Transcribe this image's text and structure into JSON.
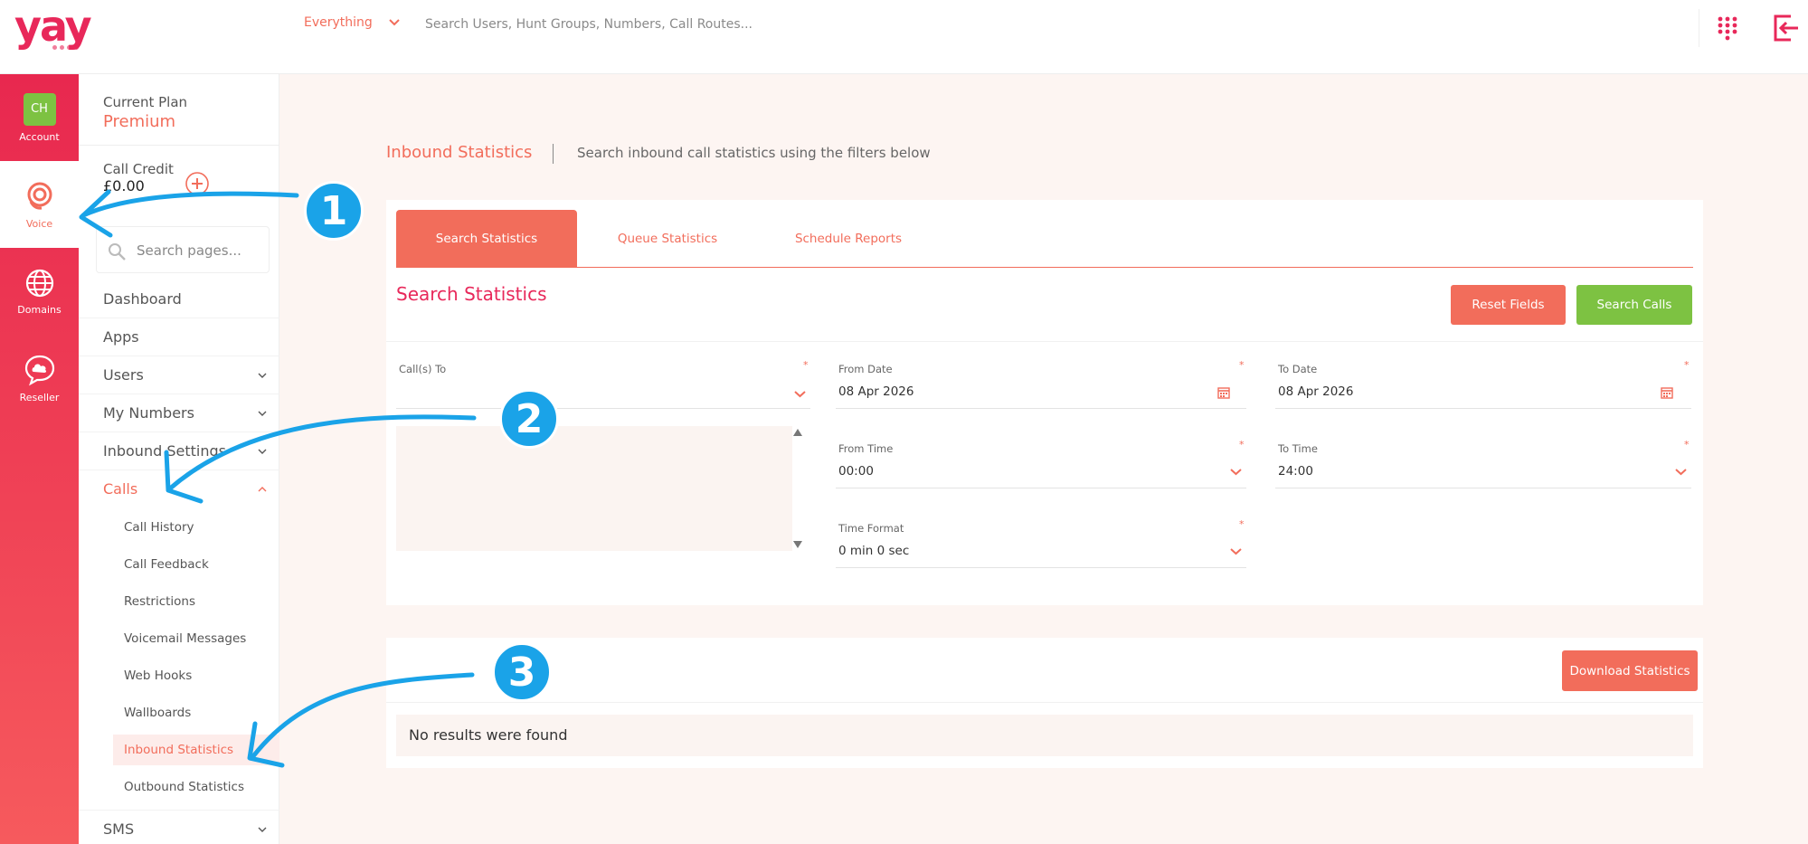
{
  "header": {
    "logo_text": "yay",
    "search_scope": "Everything",
    "search_placeholder": "Search Users, Hunt Groups, Numbers, Call Routes..."
  },
  "rail": {
    "items": [
      {
        "label": "Account",
        "avatar": "CH"
      },
      {
        "label": "Voice"
      },
      {
        "label": "Domains"
      },
      {
        "label": "Reseller"
      }
    ]
  },
  "sidebar": {
    "plan_label": "Current Plan",
    "plan_value": "Premium",
    "credit_label": "Call Credit",
    "credit_value": "£0.00",
    "search_placeholder": "Search pages...",
    "nav": [
      {
        "label": "Dashboard"
      },
      {
        "label": "Apps"
      },
      {
        "label": "Users"
      },
      {
        "label": "My Numbers"
      },
      {
        "label": "Inbound Settings"
      },
      {
        "label": "Calls"
      },
      {
        "label": "SMS"
      }
    ],
    "calls_sub": [
      {
        "label": "Call History"
      },
      {
        "label": "Call Feedback"
      },
      {
        "label": "Restrictions"
      },
      {
        "label": "Voicemail Messages"
      },
      {
        "label": "Web Hooks"
      },
      {
        "label": "Wallboards"
      },
      {
        "label": "Inbound Statistics"
      },
      {
        "label": "Outbound Statistics"
      }
    ]
  },
  "main": {
    "title": "Inbound Statistics",
    "subtitle": "Search inbound call statistics using the filters below",
    "tabs": [
      {
        "label": "Search Statistics"
      },
      {
        "label": "Queue Statistics"
      },
      {
        "label": "Schedule Reports"
      }
    ],
    "section_title": "Search Statistics",
    "reset_label": "Reset Fields",
    "search_label": "Search Calls",
    "form": {
      "calls_to_label": "Call(s) To",
      "from_date_label": "From Date",
      "from_date_value": "08 Apr 2026",
      "to_date_label": "To Date",
      "to_date_value": "08 Apr 2026",
      "from_time_label": "From Time",
      "from_time_value": "00:00",
      "to_time_label": "To Time",
      "to_time_value": "24:00",
      "time_format_label": "Time Format",
      "time_format_value": "0 min 0 sec",
      "required_mark": "*"
    },
    "download_label": "Download Statistics",
    "no_results": "No results were found"
  },
  "annotations": [
    {
      "number": "1"
    },
    {
      "number": "2"
    },
    {
      "number": "3"
    }
  ],
  "colors": {
    "brand": "#e8285a",
    "accent": "#f26d5b",
    "success": "#7dc242",
    "annotation": "#1aa3e8"
  }
}
